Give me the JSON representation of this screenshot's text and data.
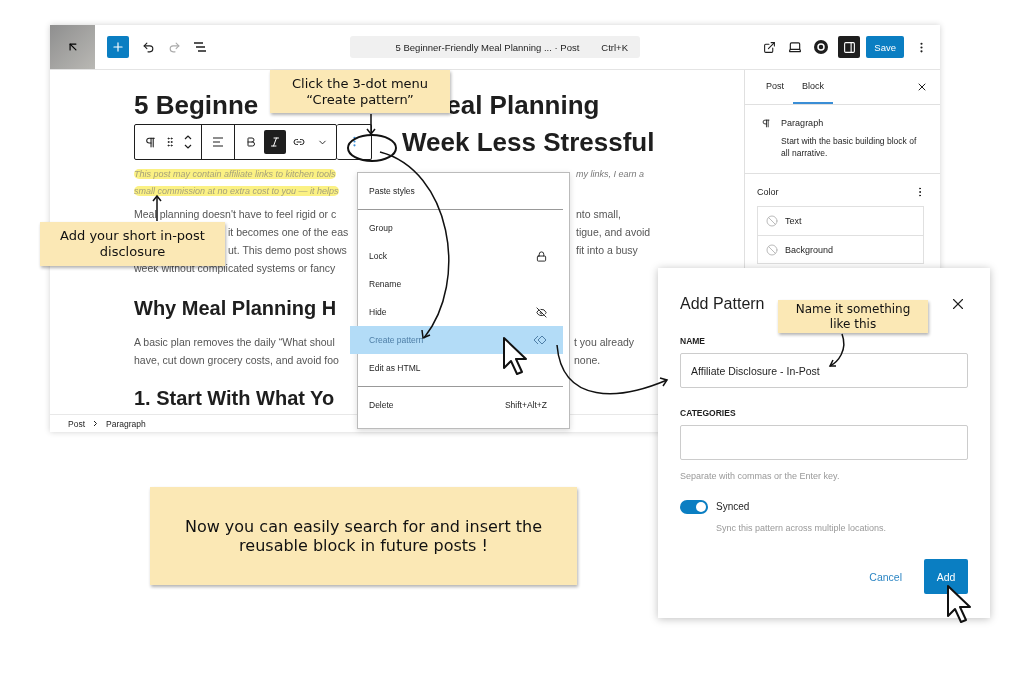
{
  "editor": {
    "topbar": {
      "document": "5 Beginner-Friendly Meal Planning ... · Post",
      "shortcut": "Ctrl+K",
      "save": "Save"
    },
    "title": {
      "line_1_start": "5 Beginne",
      "line_1_end": "eal Planning",
      "line_2_end": "Week Less Stressful"
    },
    "block_toolbar": {
      "bold": false,
      "italic": true
    },
    "disclosure_lines": [
      {
        "start": "This post may contain affiliate links to kitchen tools",
        "end": "my links, I earn a"
      },
      {
        "start": "small commission at no extra cost to you — it helps"
      }
    ],
    "paragraph_lines": [
      {
        "start": "Meal planning doesn't have to feel rigid or c",
        "end": "nto small,",
        "start_hidden": false
      },
      {
        "start": "it becomes one of the eas",
        "end": "tigue, and avoid",
        "start_hidden": true
      },
      {
        "start": "ut. This demo post shows",
        "end": "fit into a busy",
        "start_hidden": true
      },
      {
        "start": "week without complicated systems or fancy",
        "start_hidden": false
      }
    ],
    "heading_1": "Why Meal Planning H",
    "paragraph_2_lines": [
      {
        "start": "A basic plan removes the daily “What shoul",
        "end": "t you already"
      },
      {
        "start": "have, cut down grocery costs, and avoid foo",
        "end": "none."
      }
    ],
    "heading_2": "1. Start With What Yo",
    "breadcrumb": [
      "Post",
      "Paragraph"
    ]
  },
  "sidebar": {
    "tabs": [
      {
        "label": "Post",
        "selected": false
      },
      {
        "label": "Block",
        "selected": true
      }
    ],
    "block": {
      "name": "Paragraph",
      "description": "Start with the basic building block of all narrative."
    },
    "color": {
      "title": "Color",
      "items": [
        "Text",
        "Background"
      ]
    }
  },
  "block_menu": {
    "groups": [
      [
        {
          "label": "Paste styles",
          "kind": "plain",
          "selected": false
        }
      ],
      [
        {
          "label": "Group",
          "kind": "plain",
          "selected": false
        },
        {
          "label": "Lock",
          "kind": "lock",
          "selected": false
        },
        {
          "label": "Rename",
          "kind": "plain",
          "selected": false
        },
        {
          "label": "Hide",
          "kind": "visibility",
          "selected": false
        },
        {
          "label": "Create pattern",
          "kind": "pattern",
          "selected": true
        },
        {
          "label": "Edit as HTML",
          "kind": "plain",
          "selected": false
        }
      ],
      [
        {
          "label": "Delete",
          "kind": "shortcut",
          "shortcut": "Shift+Alt+Z",
          "selected": false
        }
      ]
    ]
  },
  "dialog": {
    "title": "Add Pattern",
    "name_label": "NAME",
    "name_value": "Affiliate Disclosure - In-Post",
    "categories_label": "CATEGORIES",
    "categories_help": "Separate with commas or the Enter key.",
    "synced": {
      "label": "Synced",
      "on": true,
      "help": "Sync this pattern across multiple locations."
    },
    "cancel": "Cancel",
    "add": "Add"
  },
  "notes": [
    {
      "text": "Click the 3-dot menu\n“Create pattern”"
    },
    {
      "text": "Add your short in-post\ndisclosure"
    },
    {
      "text": "Name it something\nlike this"
    },
    {
      "text": "Now you can easily search for and insert the\nreusable block in future posts !"
    }
  ]
}
